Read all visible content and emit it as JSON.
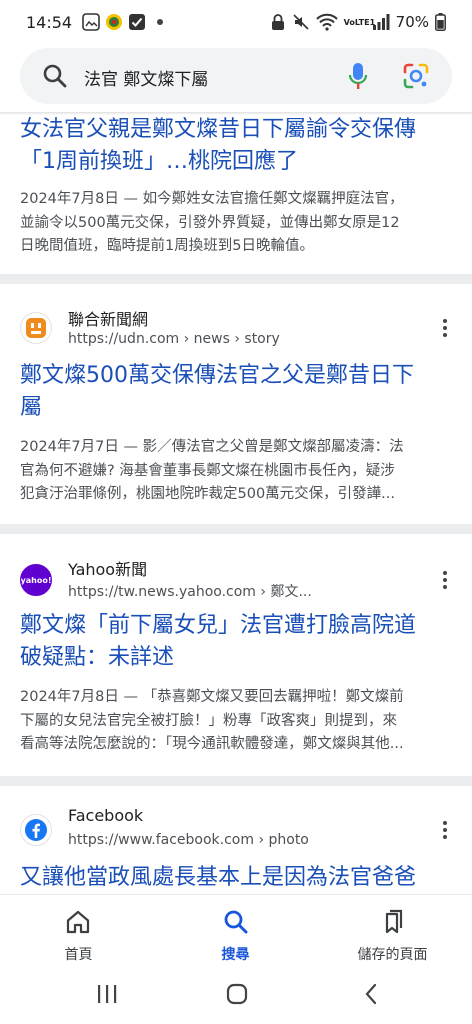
{
  "status": {
    "time": "14:54",
    "battery": "70%",
    "net_label": "VoLTE1"
  },
  "search": {
    "query": "法官 鄭文燦下屬"
  },
  "results": [
    {
      "title_lines": [
        "女法官父親是鄭文燦昔日下屬諭令交保傳",
        "「1周前換班」…桃院回應了"
      ],
      "snippet_lines": [
        "2024年7月8日 — 如今鄭姓女法官擔任鄭文燦羈押庭法官，",
        "並諭令以500萬元交保，引發外界質疑，並傳出鄭女原是12",
        "日晚間值班，臨時提前1周換班到5日晚輪值。"
      ]
    },
    {
      "source": "聯合新聞網",
      "url": "https://udn.com › news › story",
      "title_lines": [
        "鄭文燦500萬交保傳法官之父是鄭昔日下",
        "屬"
      ],
      "snippet_lines": [
        "2024年7月7日 — 影／傳法官之父曾是鄭文燦部屬凌濤：法",
        "官為何不避嫌? 海基會董事長鄭文燦在桃園市長任內，疑涉",
        "犯貪汙治罪條例，桃園地院昨裁定500萬元交保，引發譁..."
      ]
    },
    {
      "source": "Yahoo新聞",
      "logo_text": "yahoo!",
      "url": "https://tw.news.yahoo.com › 鄭文...",
      "title_lines": [
        "鄭文燦「前下屬女兒」法官遭打臉高院道",
        "破疑點：未詳述"
      ],
      "snippet_lines": [
        "2024年7月8日 — 「恭喜鄭文燦又要回去羈押啦！鄭文燦前",
        "下屬的女兒法官完全被打臉！」粉專「政客爽」則提到，來",
        "看高等法院怎麼說的：「現今通訊軟體發達，鄭文燦與其他..."
      ]
    },
    {
      "source": "Facebook",
      "url": "https://www.facebook.com › photo",
      "title_lines": [
        "又讓他當政風處長基本上是因為法官爸爸"
      ]
    }
  ],
  "nav": {
    "home": "首頁",
    "search": "搜尋",
    "saved": "儲存的頁面"
  },
  "colors": {
    "link": "#1a4fb8",
    "accent": "#1a56db",
    "divider": "#ecedef"
  }
}
